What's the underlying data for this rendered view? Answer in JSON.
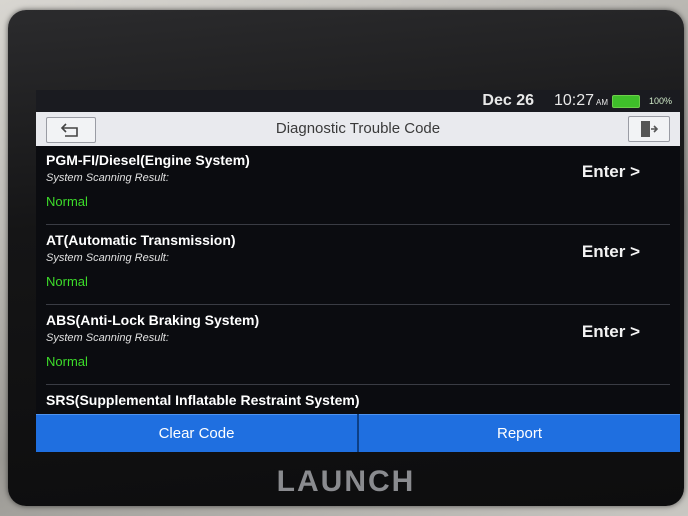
{
  "status_bar": {
    "date": "Dec 26",
    "time": "10:27",
    "ampm": "AM",
    "battery": "100%"
  },
  "header": {
    "title": "Diagnostic Trouble Code"
  },
  "systems": [
    {
      "name": "PGM-FI/Diesel(Engine System)",
      "subtitle": "System Scanning Result:",
      "status": "Normal",
      "action": "Enter >"
    },
    {
      "name": "AT(Automatic Transmission)",
      "subtitle": "System Scanning Result:",
      "status": "Normal",
      "action": "Enter >"
    },
    {
      "name": "ABS(Anti-Lock Braking System)",
      "subtitle": "System Scanning Result:",
      "status": "Normal",
      "action": "Enter >"
    },
    {
      "name": "SRS(Supplemental Inflatable Restraint System)"
    }
  ],
  "footer": {
    "clear_label": "Clear Code",
    "report_label": "Report"
  },
  "brand": "LAUNCH",
  "colors": {
    "accent_button": "#1f6fe0",
    "status_normal": "#3ddc2a"
  }
}
